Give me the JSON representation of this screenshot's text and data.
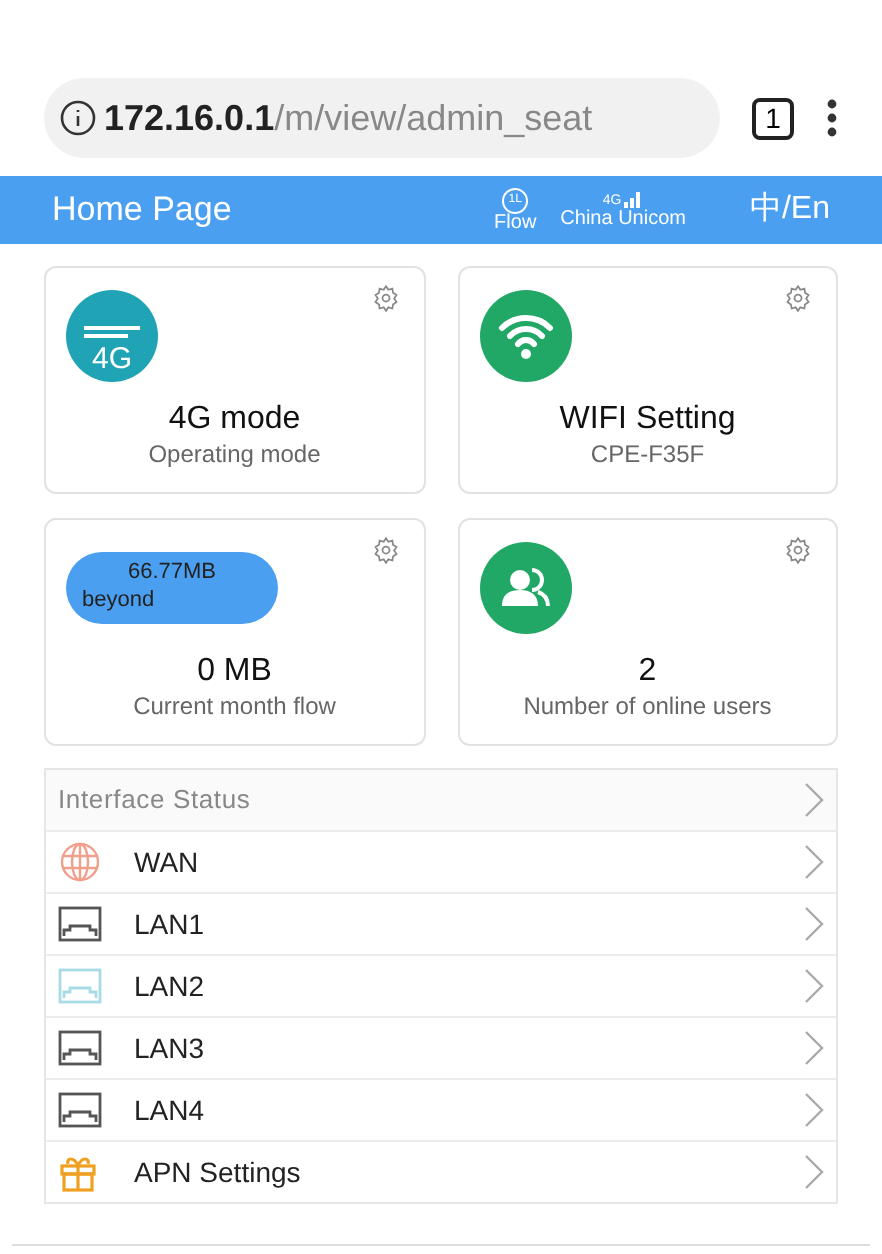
{
  "browser": {
    "url_host": "172.16.0.1",
    "url_path": "/m/view/admin_seat",
    "tab_count": "1"
  },
  "header": {
    "title": "Home Page",
    "flow_label": "Flow",
    "flow_icon_text": "1L",
    "network_tag": "4G",
    "carrier": "China Unicom",
    "language": "中/En"
  },
  "cards": [
    {
      "kind": "lte",
      "icon_text": "4G",
      "title": "4G mode",
      "subtitle": "Operating mode"
    },
    {
      "kind": "wifi",
      "title": "WIFI Setting",
      "subtitle": "CPE-F35F"
    },
    {
      "kind": "usage",
      "badge_lines": [
        "66.77MB",
        "beyond"
      ],
      "title": "0 MB",
      "subtitle": "Current month flow"
    },
    {
      "kind": "users",
      "title": "2",
      "subtitle": "Number of online users"
    }
  ],
  "list": {
    "header": "Interface Status",
    "items": [
      {
        "kind": "globe",
        "label": "WAN",
        "color": "#f0a08a"
      },
      {
        "kind": "port",
        "label": "LAN1",
        "color": "#555555"
      },
      {
        "kind": "port",
        "label": "LAN2",
        "color": "#a8dbe6"
      },
      {
        "kind": "port",
        "label": "LAN3",
        "color": "#555555"
      },
      {
        "kind": "port",
        "label": "LAN4",
        "color": "#555555"
      },
      {
        "kind": "gift",
        "label": "APN Settings",
        "color": "#f0a020"
      }
    ]
  }
}
